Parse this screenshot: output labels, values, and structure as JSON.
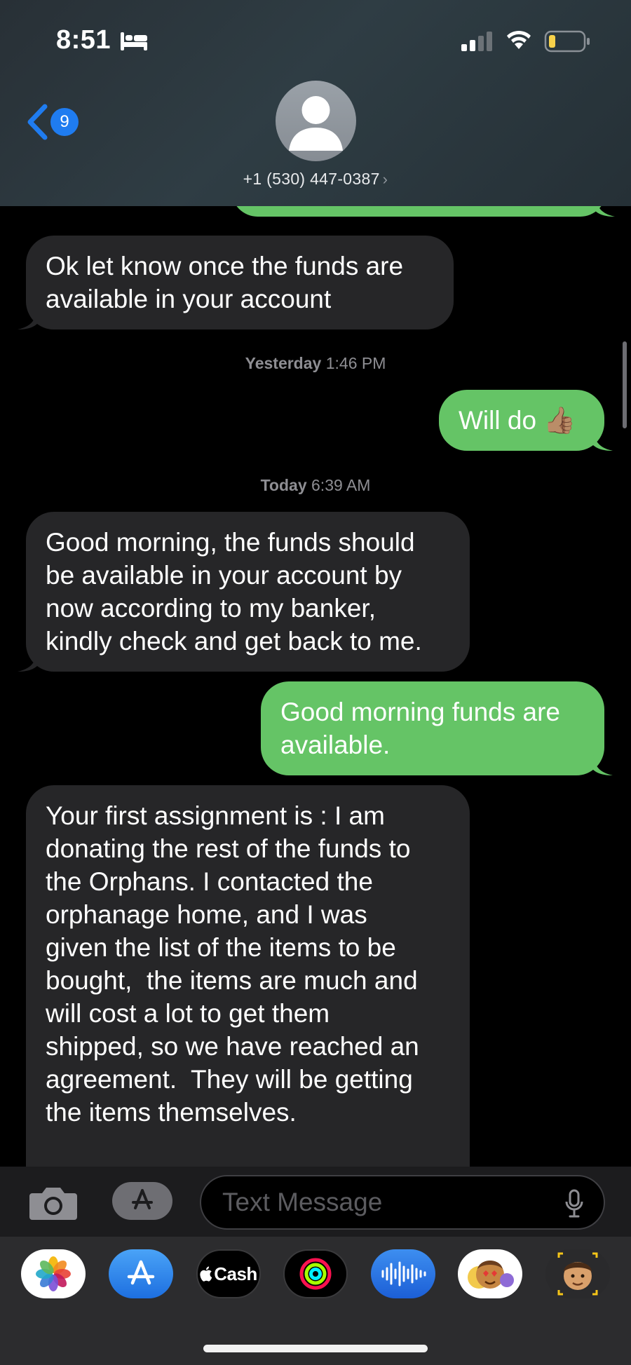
{
  "status_bar": {
    "time": "8:51",
    "icons": [
      "bed-icon",
      "cellular-signal-icon",
      "wifi-icon",
      "battery-low-icon"
    ]
  },
  "header": {
    "back_badge_count": "9",
    "contact": "+1 (530) 447-0387",
    "chevron": "›"
  },
  "messages": [
    {
      "type": "bubble",
      "direction": "outgoing",
      "text": ""
    },
    {
      "type": "bubble",
      "direction": "incoming",
      "text": "Ok let know once the funds are\navailable in your account"
    },
    {
      "type": "timestamp",
      "day": "Yesterday",
      "time": "1:46 PM"
    },
    {
      "type": "bubble",
      "direction": "outgoing",
      "text": "Will do 👍🏽"
    },
    {
      "type": "timestamp",
      "day": "Today",
      "time": "6:39 AM"
    },
    {
      "type": "bubble",
      "direction": "incoming",
      "text": "Good morning, the funds should\nbe available in your account by\nnow according to my banker,\nkindly check and get back to me."
    },
    {
      "type": "bubble",
      "direction": "outgoing",
      "text": "Good morning funds are\navailable."
    },
    {
      "type": "bubble",
      "direction": "incoming",
      "text": "Your first assignment is : I am\ndonating the rest of the funds to\nthe Orphans. I contacted the\norphanage home, and I was\ngiven the list of the items to be\nbought,  the items are much and\nwill cost a lot to get them\nshipped, so we have reached an\nagreement.  They will be getting\nthe items themselves.\n\nprice and ... funds are available ..."
    }
  ],
  "compose": {
    "placeholder": "Text Message"
  },
  "app_drawer": {
    "apps": [
      "photos-app-icon",
      "app-store-icon",
      "apple-cash-icon",
      "activity-icon",
      "voice-memo-icon",
      "memoji-stickers-icon",
      "memoji-icon"
    ],
    "cash_label": "Cash"
  },
  "colors": {
    "outgoing_bubble": "#65c466",
    "incoming_bubble": "#262628",
    "accent_blue": "#1f7cf0",
    "background": "#000000"
  }
}
